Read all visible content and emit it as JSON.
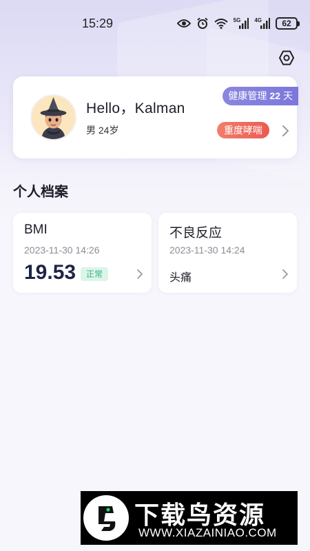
{
  "status_bar": {
    "time": "15:29",
    "network_1": "5G",
    "network_2": "4G",
    "battery": "62",
    "icons": [
      "eye-icon",
      "alarm-icon",
      "wifi-icon",
      "signal-icon",
      "signal-icon",
      "battery-icon"
    ]
  },
  "settings": {
    "icon": "settings-icon"
  },
  "profile": {
    "greeting": "Hello，Kalman",
    "gender_age": "男 24岁",
    "health_days_label": "健康管理",
    "health_days_value": "22",
    "health_days_unit": "天",
    "condition": "重度哮喘"
  },
  "section": {
    "title": "个人档案"
  },
  "records": {
    "bmi": {
      "title": "BMI",
      "date": "2023-11-30 14:26",
      "value": "19.53",
      "status": "正常"
    },
    "adverse": {
      "title": "不良反应",
      "date": "2023-11-30 14:24",
      "text": "头痛"
    }
  },
  "watermark": {
    "title": "下载鸟资源",
    "url": "WWW.XIAZAINIAO.COM"
  },
  "colors": {
    "accent": "#7c77dc",
    "danger": "#ec5a52",
    "success": "#37b381",
    "value": "#1e2447"
  }
}
